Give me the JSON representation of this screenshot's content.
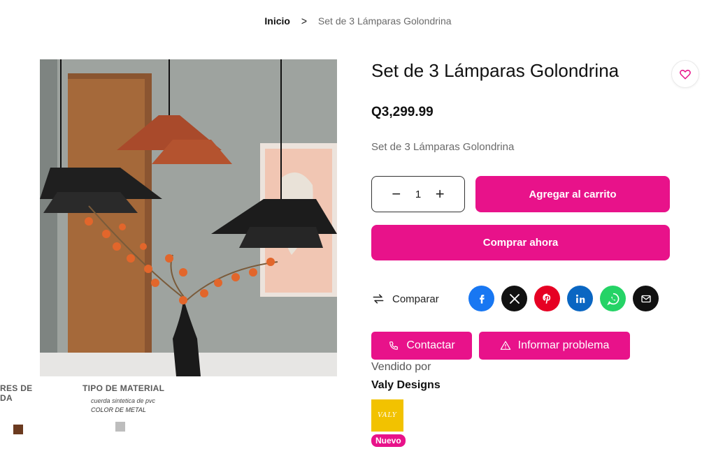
{
  "breadcrumb": {
    "home": "Inicio",
    "current": "Set de 3 Lámparas Golondrina"
  },
  "product": {
    "title": "Set de 3 Lámparas Golondrina",
    "price": "Q3,299.99",
    "short_description": "Set de 3 Lámparas Golondrina",
    "quantity": "1"
  },
  "actions": {
    "add_to_cart": "Agregar al carrito",
    "buy_now": "Comprar ahora",
    "compare": "Comparar",
    "contact": "Contactar",
    "report": "Informar problema"
  },
  "share": {
    "icons": [
      "facebook-icon",
      "x-icon",
      "pinterest-icon",
      "linkedin-icon",
      "whatsapp-icon",
      "email-icon"
    ],
    "colors": {
      "facebook": "#1877f2",
      "x": "#111111",
      "pinterest": "#e60023",
      "linkedin": "#0a66c2",
      "whatsapp": "#25d366",
      "email": "#111111"
    }
  },
  "vendor": {
    "sold_by_label": "Vendido por",
    "name": "Valy Designs",
    "logo_text": "VALY",
    "badge": "Nuevo"
  },
  "specs": {
    "left_heading_line1": "RES DE",
    "left_heading_line2": "DA",
    "right_heading": "TIPO DE MATERIAL",
    "right_line1": "cuerda sintetica de pvc",
    "right_line2": "COLOR DE METAL",
    "swatch_left": "#6b3a1f",
    "swatch_right": "#bdbdbd"
  },
  "theme": {
    "accent": "#e8128a"
  }
}
